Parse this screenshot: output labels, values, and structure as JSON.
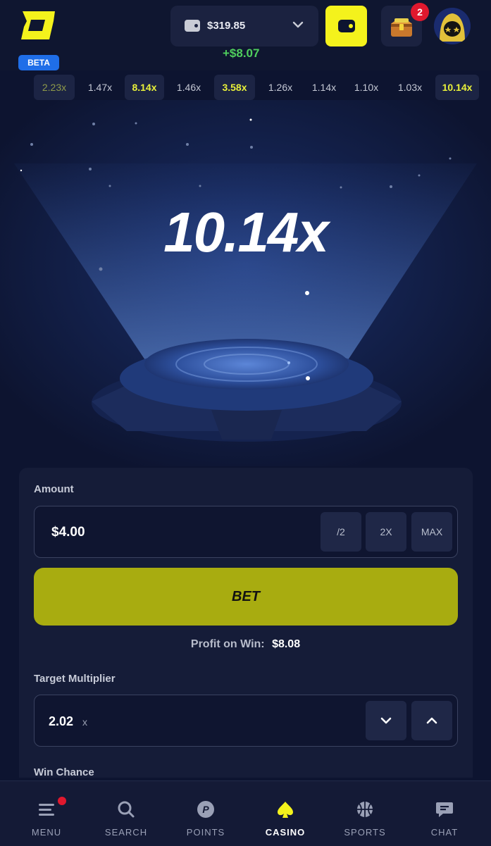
{
  "header": {
    "beta_label": "BETA",
    "balance": "$319.85",
    "profit_delta": "+$8.07",
    "notification_count": "2"
  },
  "history": [
    "2.23x",
    "1.47x",
    "8.14x",
    "1.46x",
    "3.58x",
    "1.26x",
    "1.14x",
    "1.10x",
    "1.03x",
    "10.14x"
  ],
  "game": {
    "multiplier": "10.14x"
  },
  "bet_panel": {
    "amount_label": "Amount",
    "amount_value": "$4.00",
    "half_label": "/2",
    "double_label": "2X",
    "max_label": "MAX",
    "bet_label": "BET",
    "profit_label": "Profit on Win:",
    "profit_value": "$8.08",
    "target_label": "Target Multiplier",
    "target_value": "2.02",
    "target_suffix": "x",
    "win_chance_label": "Win Chance"
  },
  "nav": {
    "items": [
      {
        "label": "MENU",
        "icon": "menu-icon"
      },
      {
        "label": "SEARCH",
        "icon": "search-icon"
      },
      {
        "label": "POINTS",
        "icon": "points-icon"
      },
      {
        "label": "CASINO",
        "icon": "spade-icon"
      },
      {
        "label": "SPORTS",
        "icon": "basketball-icon"
      },
      {
        "label": "CHAT",
        "icon": "chat-icon"
      }
    ],
    "active": "CASINO"
  },
  "colors": {
    "accent": "#f4f21c",
    "bet_button": "#a8ac10",
    "background": "#0d1430",
    "panel": "#151c38",
    "profit_green": "#4fce5d",
    "badge_red": "#e0182e",
    "beta_blue": "#1f6ee8"
  }
}
